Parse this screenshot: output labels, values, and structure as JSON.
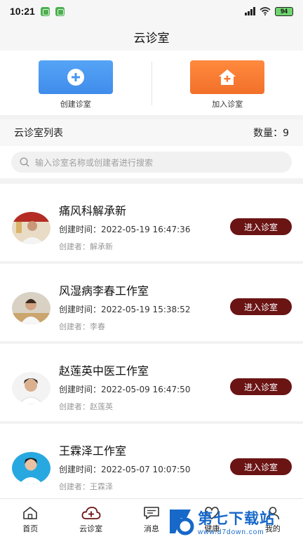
{
  "status_bar": {
    "time": "10:21",
    "battery": "94"
  },
  "header": {
    "title": "云诊室"
  },
  "actions": {
    "create_label": "创建诊室",
    "join_label": "加入诊室"
  },
  "list": {
    "title": "云诊室列表",
    "count_label": "数量：9"
  },
  "search": {
    "placeholder": "输入诊室名称或创建者进行搜索"
  },
  "clinics": [
    {
      "name": "痛风科解承新",
      "time": "创建时间：2022-05-19 16:47:36",
      "creator": "创建者：解承新",
      "button": "进入诊室"
    },
    {
      "name": "风湿病李春工作室",
      "time": "创建时间：2022-05-19 15:38:52",
      "creator": "创建者：李春",
      "button": "进入诊室"
    },
    {
      "name": "赵莲英中医工作室",
      "time": "创建时间：2022-05-09 16:47:50",
      "creator": "创建者：赵莲英",
      "button": "进入诊室"
    },
    {
      "name": "王霖泽工作室",
      "time": "创建时间：2022-05-07 10:07:50",
      "creator": "创建者：王霖泽",
      "button": "进入诊室"
    }
  ],
  "tabs": [
    {
      "label": "首页",
      "icon": "home-icon"
    },
    {
      "label": "云诊室",
      "icon": "cloud-plus-icon"
    },
    {
      "label": "消息",
      "icon": "message-icon"
    },
    {
      "label": "健康",
      "icon": "heart-icon"
    },
    {
      "label": "我的",
      "icon": "user-icon"
    }
  ],
  "watermark": {
    "brand": "第七下载站",
    "url": "www.d7down.com"
  },
  "colors": {
    "accent_blue": "#4a97f1",
    "accent_orange": "#f57a30",
    "button_maroon": "#6b1414"
  }
}
